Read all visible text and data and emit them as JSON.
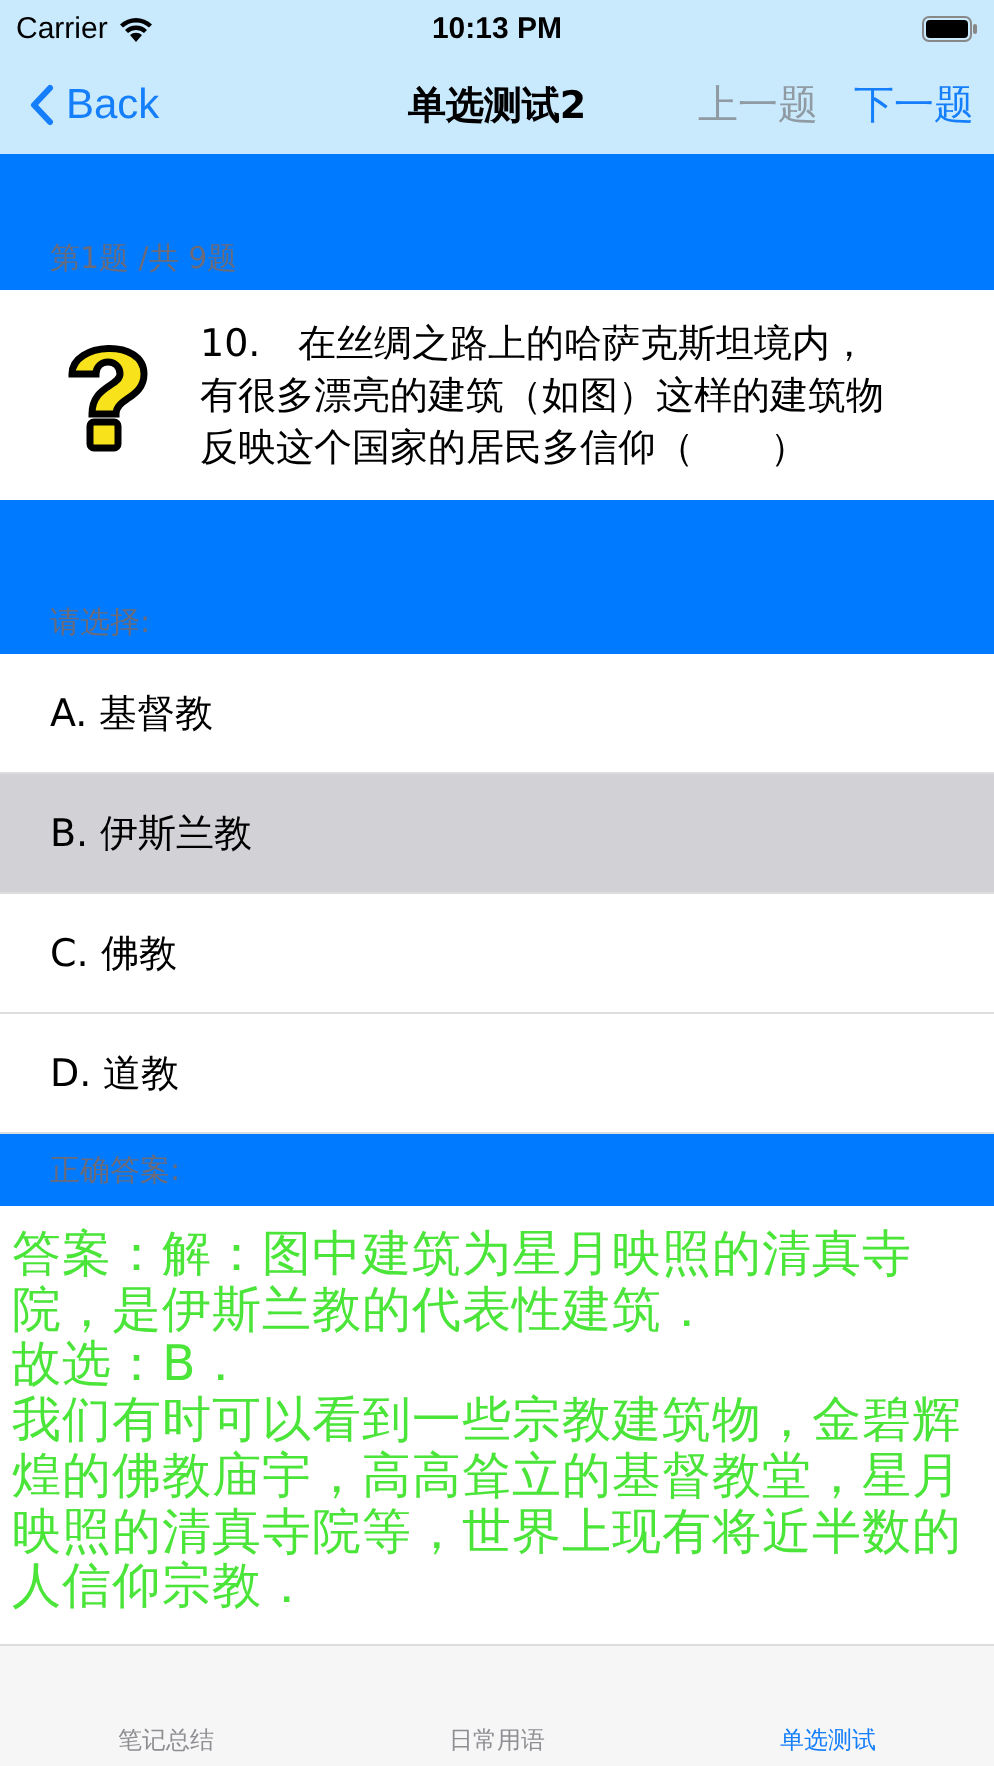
{
  "status_bar": {
    "carrier": "Carrier",
    "time": "10:13 PM"
  },
  "nav_bar": {
    "back": "Back",
    "title": "单选测试2",
    "prev": {
      "label": "上一题",
      "disabled": true
    },
    "next": {
      "label": "下一题",
      "disabled": false
    }
  },
  "progress": "第1题 /共 9题",
  "question": "10.　在丝绸之路上的哈萨克斯坦境内，有很多漂亮的建筑（如图）这样的建筑物反映这个国家的居民多信仰（　　）",
  "choose_label": "请选择:",
  "options": [
    {
      "label": "A. 基督教",
      "selected": false
    },
    {
      "label": "B. 伊斯兰教",
      "selected": true
    },
    {
      "label": "C. 佛教",
      "selected": false
    },
    {
      "label": "D. 道教",
      "selected": false
    }
  ],
  "answer_label": "正确答案:",
  "answer": [
    "答案：解：图中建筑为星月映照的清真寺院，是伊斯兰教的代表性建筑．",
    "故选：B．",
    "我们有时可以看到一些宗教建筑物，金碧辉煌的佛教庙宇，高高耸立的基督教堂，星月映照的清真寺院等，世界上现有将近半数的人信仰宗教．"
  ],
  "tabs": [
    {
      "label": "笔记总结",
      "selected": false
    },
    {
      "label": "日常用语",
      "selected": false
    },
    {
      "label": "单选测试",
      "selected": true
    }
  ]
}
